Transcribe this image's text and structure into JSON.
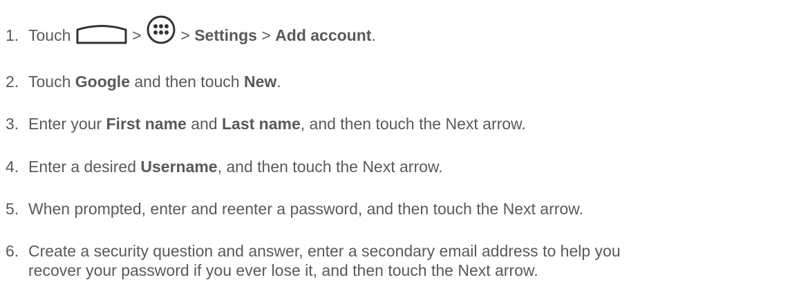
{
  "steps": [
    {
      "num": "1.",
      "parts": {
        "t1": "Touch",
        "home_icon": "home-icon",
        "gt1": ">",
        "apps_icon": "all-apps-icon",
        "gt2": ">",
        "b1": "Settings",
        "gt3": ">",
        "b2": "Add account",
        "end": "."
      }
    },
    {
      "num": "2.",
      "parts": {
        "t1": "Touch",
        "b1": "Google",
        "t2": "and then touch",
        "b2": "New",
        "end": "."
      }
    },
    {
      "num": "3.",
      "parts": {
        "t1": "Enter your",
        "b1": "First name",
        "t2": "and",
        "b2": "Last name",
        "t3": ", and then touch the Next arrow."
      }
    },
    {
      "num": "4.",
      "parts": {
        "t1": "Enter a desired",
        "b1": "Username",
        "t2": ", and then touch the Next arrow."
      }
    },
    {
      "num": "5.",
      "text": "When prompted, enter and reenter a password, and then touch the Next arrow."
    },
    {
      "num": "6.",
      "line1": "Create a security question and answer, enter a secondary email address to help you",
      "line2": "recover your password if you ever lose it, and then touch the Next arrow."
    }
  ],
  "colors": {
    "text": "#595959"
  }
}
